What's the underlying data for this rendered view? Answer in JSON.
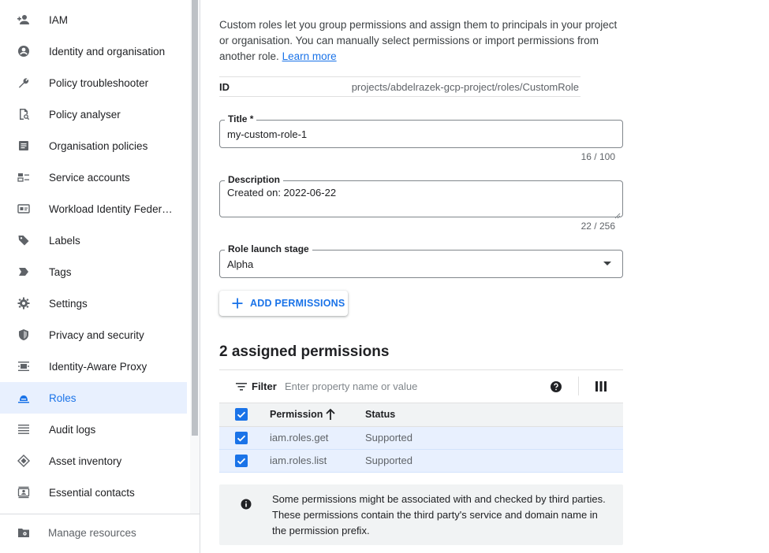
{
  "sidebar": {
    "items": [
      {
        "label": "IAM",
        "icon": "person-add-icon",
        "active": false
      },
      {
        "label": "Identity and organisation",
        "icon": "account-circle-icon",
        "active": false
      },
      {
        "label": "Policy troubleshooter",
        "icon": "wrench-icon",
        "active": false
      },
      {
        "label": "Policy analyser",
        "icon": "document-search-icon",
        "active": false
      },
      {
        "label": "Organisation policies",
        "icon": "list-document-icon",
        "active": false
      },
      {
        "label": "Service accounts",
        "icon": "service-account-icon",
        "active": false
      },
      {
        "label": "Workload Identity Federat...",
        "icon": "id-card-icon",
        "active": false
      },
      {
        "label": "Labels",
        "icon": "label-tag-icon",
        "active": false
      },
      {
        "label": "Tags",
        "icon": "tag-arrow-icon",
        "active": false
      },
      {
        "label": "Settings",
        "icon": "gear-icon",
        "active": false
      },
      {
        "label": "Privacy and security",
        "icon": "shield-icon",
        "active": false
      },
      {
        "label": "Identity-Aware Proxy",
        "icon": "proxy-icon",
        "active": false
      },
      {
        "label": "Roles",
        "icon": "roles-hat-icon",
        "active": true
      },
      {
        "label": "Audit logs",
        "icon": "lines-icon",
        "active": false
      },
      {
        "label": "Asset inventory",
        "icon": "diamond-stack-icon",
        "active": false
      },
      {
        "label": "Essential contacts",
        "icon": "contacts-icon",
        "active": false
      }
    ],
    "manage_resources": "Manage resources"
  },
  "main": {
    "intro_text": "Custom roles let you group permissions and assign them to principals in your project or organisation. You can manually select permissions or import permissions from another role.",
    "learn_more": "Learn more",
    "id_label": "ID",
    "id_value": "projects/abdelrazek-gcp-project/roles/CustomRole",
    "title_label": "Title *",
    "title_value": "my-custom-role-1",
    "title_counter": "16 / 100",
    "description_label": "Description",
    "description_value": "Created on: 2022-06-22",
    "description_counter": "22 / 256",
    "launch_stage_label": "Role launch stage",
    "launch_stage_value": "Alpha",
    "add_permissions_label": "ADD PERMISSIONS",
    "assigned_heading": "2 assigned permissions",
    "filter_label": "Filter",
    "filter_placeholder": "Enter property name or value",
    "columns": {
      "permission": "Permission",
      "status": "Status"
    },
    "rows": [
      {
        "permission": "iam.roles.get",
        "status": "Supported",
        "checked": true
      },
      {
        "permission": "iam.roles.list",
        "status": "Supported",
        "checked": true
      }
    ],
    "info_text": "Some permissions might be associated with and checked by third parties. These permissions contain the third party's service and domain name in the permission prefix."
  },
  "colors": {
    "accent": "#1a73e8",
    "active_bg": "#e8f0fe",
    "text": "#202124",
    "muted": "#5f6368"
  }
}
